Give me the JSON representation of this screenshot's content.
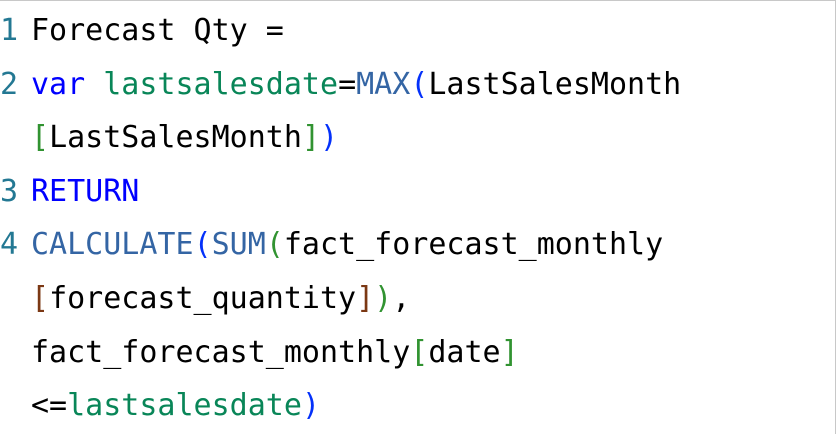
{
  "editor": {
    "lines": [
      {
        "num": "1",
        "tokens": [
          {
            "t": "Forecast Qty =",
            "c": "id"
          }
        ]
      },
      {
        "num": "2",
        "tokens": [
          {
            "t": "var",
            "c": "kw"
          },
          {
            "t": " ",
            "c": "id"
          },
          {
            "t": "lastsalesdate",
            "c": "var"
          },
          {
            "t": "=",
            "c": "op"
          },
          {
            "t": "MAX",
            "c": "fn"
          },
          {
            "t": "(",
            "c": "pr1"
          },
          {
            "t": "LastSalesMonth",
            "c": "id"
          }
        ]
      },
      {
        "num": "",
        "tokens": [
          {
            "t": "[",
            "c": "pr2"
          },
          {
            "t": "LastSalesMonth",
            "c": "col"
          },
          {
            "t": "]",
            "c": "pr2"
          },
          {
            "t": ")",
            "c": "pr1"
          }
        ]
      },
      {
        "num": "3",
        "tokens": [
          {
            "t": "RETURN",
            "c": "kw"
          }
        ]
      },
      {
        "num": "4",
        "tokens": [
          {
            "t": "CALCULATE",
            "c": "fn"
          },
          {
            "t": "(",
            "c": "pr1"
          },
          {
            "t": "SUM",
            "c": "fn"
          },
          {
            "t": "(",
            "c": "pr2"
          },
          {
            "t": "fact_forecast_monthly",
            "c": "id"
          }
        ]
      },
      {
        "num": "",
        "tokens": [
          {
            "t": "[",
            "c": "pr3"
          },
          {
            "t": "forecast_quantity",
            "c": "col"
          },
          {
            "t": "]",
            "c": "pr3"
          },
          {
            "t": ")",
            "c": "pr2"
          },
          {
            "t": ",",
            "c": "op"
          }
        ]
      },
      {
        "num": "",
        "tokens": [
          {
            "t": "fact_forecast_monthly",
            "c": "id"
          },
          {
            "t": "[",
            "c": "pr2"
          },
          {
            "t": "date",
            "c": "col"
          },
          {
            "t": "]",
            "c": "pr2"
          }
        ]
      },
      {
        "num": "",
        "tokens": [
          {
            "t": "<=",
            "c": "op"
          },
          {
            "t": "lastsalesdate",
            "c": "var"
          },
          {
            "t": ")",
            "c": "pr1"
          }
        ]
      }
    ]
  },
  "colors": {
    "line_number": "#237893",
    "keyword": "#0000ff",
    "function": "#3465a4",
    "variable": "#098658",
    "bracket_level1": "#0431fa",
    "bracket_level2": "#319331",
    "bracket_level3": "#7b3814",
    "text": "#000000",
    "background": "#ffffff"
  }
}
